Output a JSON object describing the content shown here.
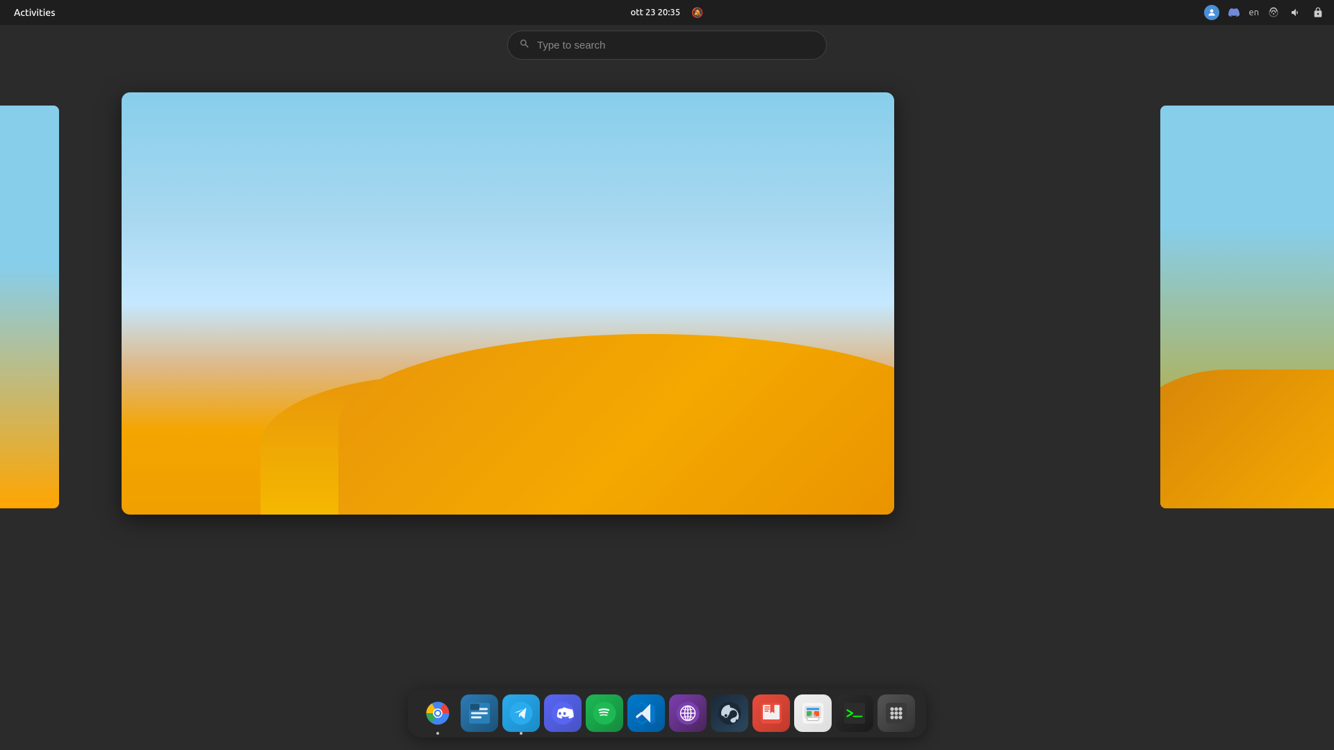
{
  "topbar": {
    "activities_label": "Activities",
    "datetime": "ott 23  20:35",
    "language": "en",
    "bell_icon": "🔕"
  },
  "search": {
    "placeholder": "Type to search"
  },
  "dock": {
    "items": [
      {
        "id": "chromium",
        "label": "Chromium",
        "icon_type": "chromium",
        "has_dot": true
      },
      {
        "id": "files",
        "label": "Files",
        "icon_type": "files",
        "has_dot": false
      },
      {
        "id": "telegram",
        "label": "Telegram",
        "icon_type": "telegram",
        "has_dot": true
      },
      {
        "id": "discord",
        "label": "Discord",
        "icon_type": "discord",
        "has_dot": false
      },
      {
        "id": "spotify",
        "label": "Spotify",
        "icon_type": "spotify",
        "has_dot": false
      },
      {
        "id": "vscode",
        "label": "VS Code",
        "icon_type": "vscode",
        "has_dot": false
      },
      {
        "id": "gnome-web",
        "label": "GNOME Web",
        "icon_type": "gnome-web",
        "has_dot": false
      },
      {
        "id": "steam",
        "label": "Steam",
        "icon_type": "steam",
        "has_dot": false
      },
      {
        "id": "bookmarks",
        "label": "Bookmarks",
        "icon_type": "bookmarks",
        "has_dot": false
      },
      {
        "id": "store",
        "label": "GNOME Software",
        "icon_type": "store",
        "has_dot": false
      },
      {
        "id": "terminal",
        "label": "Terminal",
        "icon_type": "terminal",
        "has_dot": false
      },
      {
        "id": "apps",
        "label": "Show Apps",
        "icon_type": "apps",
        "has_dot": false
      }
    ]
  }
}
